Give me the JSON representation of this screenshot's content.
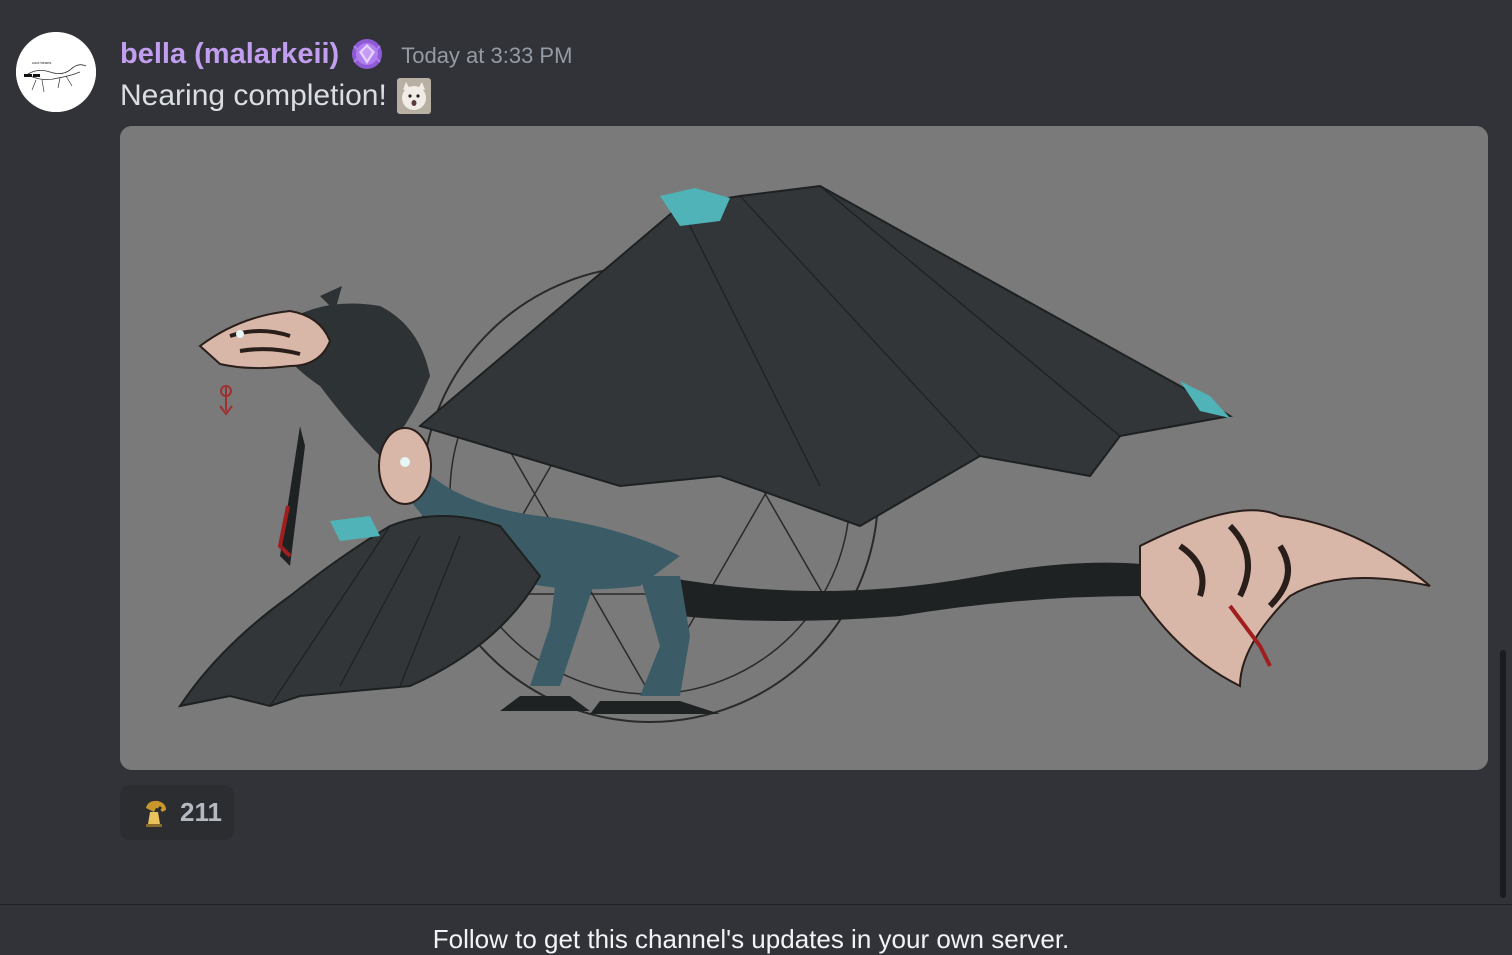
{
  "message": {
    "username": "bella (malarkeii)",
    "role_badge_icon": "purple-gem-badge-icon",
    "timestamp": "Today at 3:33 PM",
    "content": "Nearing completion!",
    "content_emoji_icon": "cat-face-emoji-icon",
    "avatar_icon": "cool-beans-lizard-avatar",
    "avatar_text": "cool beans",
    "attachment": {
      "icon": "dragon-artwork-image",
      "background_color": "#7a7a7a"
    },
    "reaction": {
      "emoji_icon": "golden-statue-emoji-icon",
      "count": "211"
    }
  },
  "footer": {
    "follow_text": "Follow to get this channel's updates in your own server."
  },
  "colors": {
    "background": "#313338",
    "username": "#c29ef0",
    "timestamp": "#949ba4",
    "content": "#dbdee1",
    "reaction_bg": "#2b2d31"
  }
}
